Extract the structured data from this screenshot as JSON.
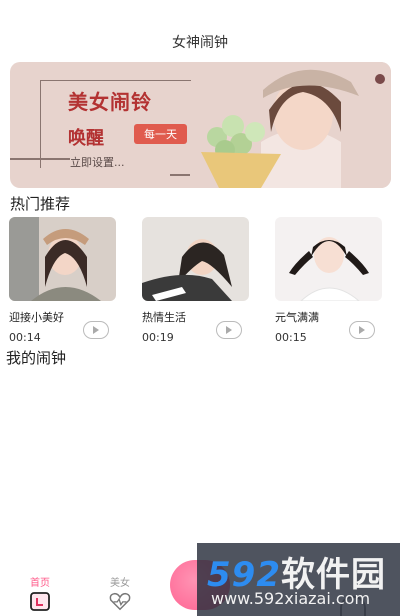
{
  "header": {
    "title": "女神闹钟"
  },
  "banner": {
    "title": "美女闹铃",
    "subtitle": "唤醒",
    "tag": "每一天",
    "cta": "立即设置..."
  },
  "hot": {
    "title": "热门推荐",
    "items": [
      {
        "name": "迎接小美好",
        "duration": "00:14"
      },
      {
        "name": "热情生活",
        "duration": "00:19"
      },
      {
        "name": "元气满满",
        "duration": "00:15"
      }
    ]
  },
  "mine": {
    "title": "我的闹钟"
  },
  "tabbar": {
    "items": [
      {
        "label": "首页",
        "icon": "calendar-icon"
      },
      {
        "label": "美女",
        "icon": "heart-icon"
      }
    ]
  },
  "watermark": {
    "brand_num": "592",
    "brand_cn": "软件园",
    "url": "www.592xiazai.com"
  },
  "colors": {
    "accent": "#ff5a8a",
    "banner_text": "#b33232",
    "banner_bg": "#e7d3cd"
  }
}
